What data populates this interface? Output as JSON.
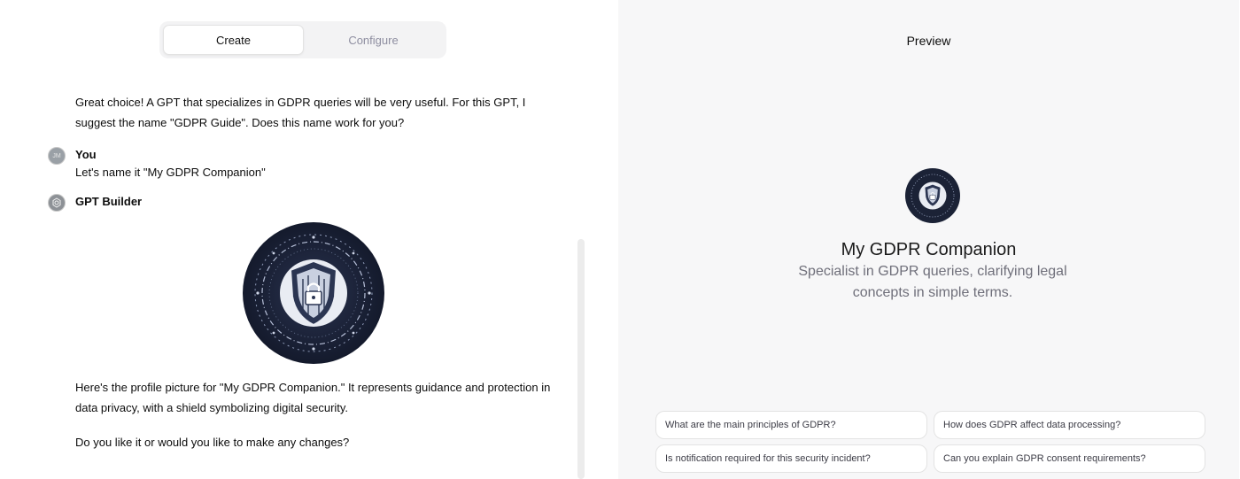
{
  "tabs": {
    "create": "Create",
    "configure": "Configure"
  },
  "chat": {
    "builder_message_1": "Great choice! A GPT that specializes in GDPR queries will be very useful. For this GPT, I suggest the name \"GDPR Guide\". Does this name work for you?",
    "user_initials": "JM",
    "user_author": "You",
    "user_message": "Let's name it \"My GDPR Companion\"",
    "builder_author": "GPT Builder",
    "builder_message_2": "Here's the profile picture for \"My GDPR Companion.\" It represents guidance and protection in data privacy, with a shield symbolizing digital security.",
    "builder_message_3": "Do you like it or would you like to make any changes?"
  },
  "preview": {
    "title": "Preview",
    "gpt_name": "My GDPR Companion",
    "gpt_description": "Specialist in GDPR queries, clarifying legal concepts in simple terms.",
    "conversation_starters": [
      "What are the main principles of GDPR?",
      "How does GDPR affect data processing?",
      "Is notification required for this security incident?",
      "Can you explain GDPR consent requirements?"
    ]
  },
  "icons": {
    "profile_image": "shield-lock-icon",
    "builder_avatar": "openai-logo-icon"
  },
  "colors": {
    "profile_bg": "#1b2236",
    "preview_bg": "#f7f7f8",
    "muted_text": "#6f6f7a"
  }
}
